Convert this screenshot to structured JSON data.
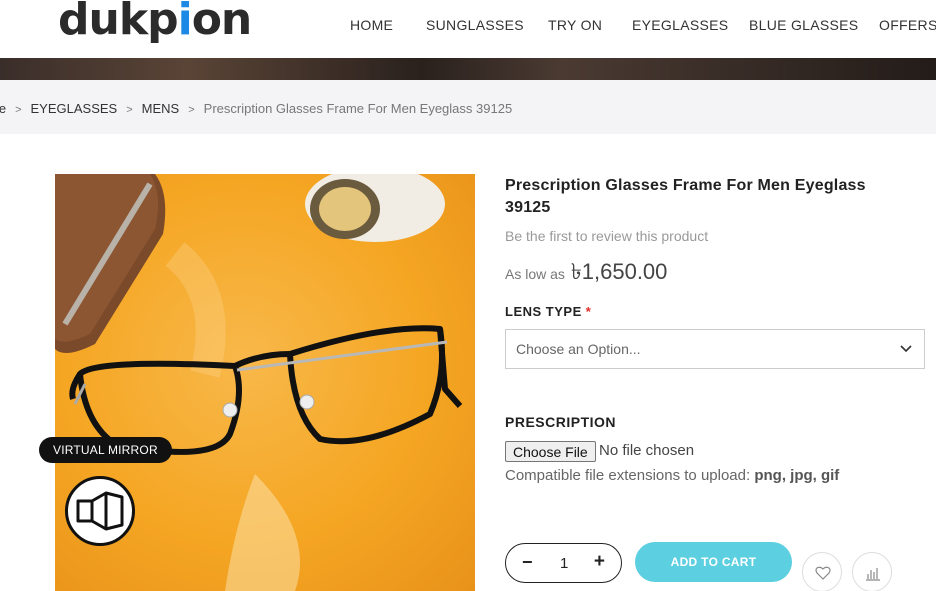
{
  "header": {
    "logo": {
      "part1": "duk",
      "part2": "p",
      "part3": "i",
      "part4": "on"
    },
    "nav": [
      "HOME",
      "SUNGLASSES",
      "TRY ON",
      "EYEGLASSES",
      "BLUE GLASSES",
      "OFFERS"
    ]
  },
  "breadcrumb": {
    "items": [
      "me",
      "EYEGLASSES",
      "MENS"
    ],
    "current": "Prescription Glasses Frame For Men Eyeglass 39125"
  },
  "product": {
    "title": "Prescription Glasses Frame For Men Eyeglass 39125",
    "review_text": "Be the first to review this product",
    "price_prefix": "As low as",
    "price": "৳1,650.00",
    "virtual_mirror_label": "VIRTUAL MIRROR"
  },
  "options": {
    "lens_type_label": "LENS TYPE",
    "required_mark": "*",
    "lens_select_value": "Choose an Option...",
    "prescription_label": "PRESCRIPTION",
    "file_button": "Choose File",
    "file_status": "No file chosen",
    "file_note_prefix": "Compatible file extensions to upload:",
    "file_note_exts": "png, jpg, gif"
  },
  "cart": {
    "qty_minus": "−",
    "qty_value": "1",
    "qty_plus": "+",
    "add_to_cart": "ADD TO CART"
  },
  "colors": {
    "accent": "#5ccfe0",
    "logo_blue": "#1e88e5",
    "photo_bg": "#f5a623"
  },
  "icons": [
    "chevron-down-icon",
    "virtual-mirror-icon",
    "heart-icon",
    "compare-icon"
  ]
}
